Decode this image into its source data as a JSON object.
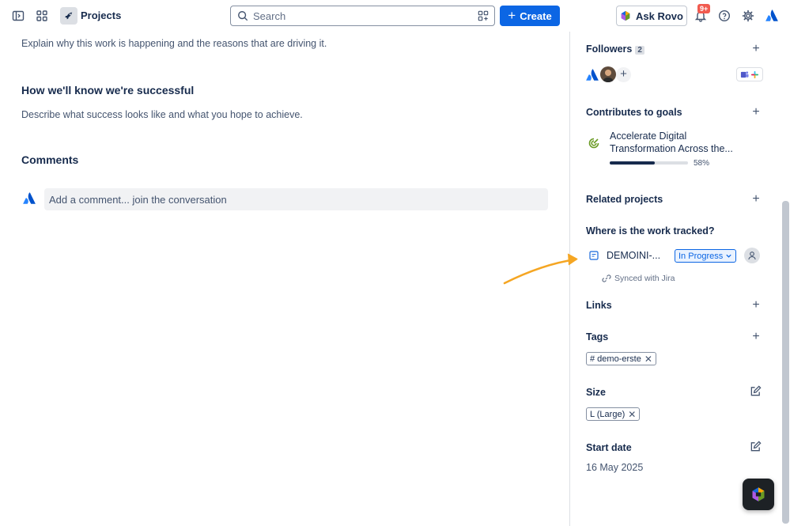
{
  "topbar": {
    "project_title": "Projects",
    "search_placeholder": "Search",
    "create_label": "Create",
    "ask_rovo_label": "Ask Rovo",
    "notifications_badge": "9+"
  },
  "main": {
    "purpose_text": "Explain why this work is happening and the reasons that are driving it.",
    "success_heading": "How we'll know we're successful",
    "success_text": "Describe what success looks like and what you hope to achieve.",
    "comments_heading": "Comments",
    "comment_placeholder": "Add a comment... join the conversation"
  },
  "sidebar": {
    "followers": {
      "heading": "Followers",
      "count": "2"
    },
    "goals": {
      "heading": "Contributes to goals",
      "goal_title": "Accelerate Digital Transformation Across the...",
      "progress_label": "58%",
      "progress_value": 58
    },
    "related": {
      "heading": "Related projects"
    },
    "tracked": {
      "heading": "Where is the work tracked?",
      "work_key": "DEMOINI-...",
      "status": "In Progress",
      "synced_text": "Synced with Jira"
    },
    "links": {
      "heading": "Links"
    },
    "tags": {
      "heading": "Tags",
      "items": [
        "# demo-erste"
      ]
    },
    "size": {
      "heading": "Size",
      "value": "L (Large)"
    },
    "start_date": {
      "heading": "Start date",
      "value": "16 May 2025"
    }
  },
  "colors": {
    "primary": "#0c66e4",
    "text": "#172b4d",
    "subtle_text": "#44546f",
    "annotation_arrow": "#f5a623",
    "badge": "#f15b50"
  }
}
